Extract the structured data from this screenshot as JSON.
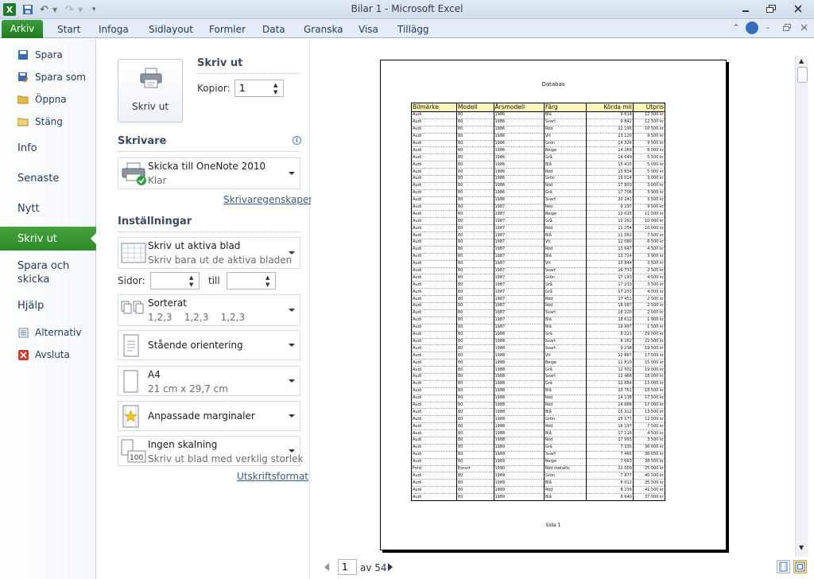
{
  "window": {
    "title": "Bilar 1  -  Microsoft Excel"
  },
  "tabs": [
    "Arkiv",
    "Start",
    "Infoga",
    "Sidlayout",
    "Formler",
    "Data",
    "Granska",
    "Visa",
    "Tillägg"
  ],
  "nav": {
    "spara": "Spara",
    "spara_som": "Spara som",
    "oppna": "Öppna",
    "stang": "Stäng",
    "info": "Info",
    "senaste": "Senaste",
    "nytt": "Nytt",
    "skriv_ut": "Skriv ut",
    "spara_skicka": "Spara och skicka",
    "hjalp": "Hjälp",
    "alternativ": "Alternativ",
    "avsluta": "Avsluta"
  },
  "print": {
    "button_label": "Skriv ut",
    "heading": "Skriv ut",
    "copies_label": "Kopior:",
    "copies_value": "1",
    "printer_heading": "Skrivare",
    "printer_name": "Skicka till OneNote 2010",
    "printer_status": "Klar",
    "printer_props": "Skrivaregenskaper",
    "settings_heading": "Inställningar",
    "what_title": "Skriv ut aktiva blad",
    "what_sub": "Skriv bara ut de aktiva bladen",
    "pages_label": "Sidor:",
    "to_label": "till",
    "collate_title": "Sorterat",
    "collate_sub": "1,2,3    1,2,3    1,2,3",
    "orientation": "Stående orientering",
    "paper_title": "A4",
    "paper_sub": "21 cm x 29,7 cm",
    "margins": "Anpassade marginaler",
    "scaling_title": "Ingen skalning",
    "scaling_sub": "Skriv ut blad med verklig storlek",
    "page_setup": "Utskriftsformat"
  },
  "preview": {
    "page_title": "Databas",
    "page_footer": "Sida 1",
    "current_page": "1",
    "page_total": "av 54",
    "headers": [
      "Bilmärke",
      "Modell",
      "Årsmodell",
      "Färg",
      "Körda mil",
      "Utpris"
    ],
    "rows": [
      [
        "Audi",
        "80",
        "1986",
        "Blå",
        "9 614",
        "12 500 kr"
      ],
      [
        "Audi",
        "80",
        "1986",
        "Svart",
        "9 842",
        "12 500 kr"
      ],
      [
        "Audi",
        "80",
        "1986",
        "Röd",
        "11 195",
        "10 500 kr"
      ],
      [
        "Audi",
        "80",
        "1986",
        "Vit",
        "13 120",
        "9 500 kr"
      ],
      [
        "Audi",
        "80",
        "1986",
        "Grön",
        "14 326",
        "9 500 kr"
      ],
      [
        "Audi",
        "80",
        "1986",
        "Beige",
        "14 269",
        "8 000 kr"
      ],
      [
        "Audi",
        "80",
        "1986",
        "Grå",
        "14 649",
        "5 500 kr"
      ],
      [
        "Audi",
        "80",
        "1986",
        "Blå",
        "15 415",
        "5 000 kr"
      ],
      [
        "Audi",
        "80",
        "1986",
        "Röd",
        "15 834",
        "5 000 kr"
      ],
      [
        "Audi",
        "80",
        "1986",
        "Grön",
        "16 014",
        "3 000 kr"
      ],
      [
        "Audi",
        "80",
        "1986",
        "Röd",
        "17 803",
        "3 000 kr"
      ],
      [
        "Audi",
        "80",
        "1986",
        "Grå",
        "17 706",
        "3 900 kr"
      ],
      [
        "Audi",
        "80",
        "1986",
        "Svart",
        "20 241",
        "3 500 kr"
      ],
      [
        "Audi",
        "80",
        "1987",
        "Röd",
        "9 297",
        "9 500 kr"
      ],
      [
        "Audi",
        "80",
        "1987",
        "Beige",
        "10 025",
        "11 500 kr"
      ],
      [
        "Audi",
        "80",
        "1987",
        "Grå",
        "10 262",
        "10 000 kr"
      ],
      [
        "Audi",
        "80",
        "1987",
        "Röd",
        "11 254",
        "10 000 kr"
      ],
      [
        "Audi",
        "80",
        "1987",
        "Blå",
        "11 562",
        "7 500 kr"
      ],
      [
        "Audi",
        "80",
        "1987",
        "Vit",
        "12 080",
        "6 500 kr"
      ],
      [
        "Audi",
        "80",
        "1987",
        "Röd",
        "13 647",
        "4 500 kr"
      ],
      [
        "Audi",
        "80",
        "1987",
        "Blå",
        "13 724",
        "3 900 kr"
      ],
      [
        "Audi",
        "80",
        "1987",
        "Vit",
        "13 844",
        "3 500 kr"
      ],
      [
        "Audi",
        "80",
        "1987",
        "Svart",
        "16 733",
        "2 500 kr"
      ],
      [
        "Audi",
        "80",
        "1987",
        "Grön",
        "17 193",
        "4 500 kr"
      ],
      [
        "Audi",
        "80",
        "1987",
        "Grå",
        "17 233",
        "3 500 kr"
      ],
      [
        "Audi",
        "80",
        "1987",
        "Grå",
        "17 233",
        "4 000 kr"
      ],
      [
        "Audi",
        "80",
        "1987",
        "Röd",
        "17 451",
        "2 500 kr"
      ],
      [
        "Audi",
        "80",
        "1987",
        "Röd",
        "18 087",
        "2 500 kr"
      ],
      [
        "Audi",
        "80",
        "1987",
        "Svart",
        "18 220",
        "2 000 kr"
      ],
      [
        "Audi",
        "80",
        "1987",
        "Blå",
        "18 612",
        "1 900 kr"
      ],
      [
        "Audi",
        "80",
        "1987",
        "Blå",
        "19 997",
        "1 500 kr"
      ],
      [
        "Audi",
        "80",
        "1988",
        "Grå",
        "8 221",
        "29 000 kr"
      ],
      [
        "Audi",
        "80",
        "1988",
        "Svart",
        "8 262",
        "22 500 kr"
      ],
      [
        "Audi",
        "80",
        "1988",
        "Svart",
        "9 238",
        "19 500 kr"
      ],
      [
        "Audi",
        "80",
        "1988",
        "Vit",
        "10 867",
        "17 500 kr"
      ],
      [
        "Audi",
        "80",
        "1988",
        "Beige",
        "11 810",
        "15 000 kr"
      ],
      [
        "Audi",
        "80",
        "1988",
        "Grå",
        "12 502",
        "19 000 kr"
      ],
      [
        "Audi",
        "80",
        "1988",
        "Svart",
        "12 468",
        "18 000 kr"
      ],
      [
        "Audi",
        "80",
        "1988",
        "Grå",
        "12 884",
        "13 000 kr"
      ],
      [
        "Audi",
        "80",
        "1988",
        "Blå",
        "13 761",
        "18 500 kr"
      ],
      [
        "Audi",
        "80",
        "1988",
        "Röd",
        "14 138",
        "17 500 kr"
      ],
      [
        "Audi",
        "80",
        "1988",
        "Röd",
        "14 986",
        "17 000 kr"
      ],
      [
        "Audi",
        "80",
        "1988",
        "Blå",
        "15 312",
        "13 500 kr"
      ],
      [
        "Audi",
        "80",
        "1988",
        "Grön",
        "15 577",
        "12 500 kr"
      ],
      [
        "Audi",
        "80",
        "1988",
        "Röd",
        "16 197",
        "7 500 kr"
      ],
      [
        "Audi",
        "80",
        "1988",
        "Blå",
        "17 116",
        "4 500 kr"
      ],
      [
        "Audi",
        "80",
        "1988",
        "Röd",
        "17 993",
        "3 500 kr"
      ],
      [
        "Audi",
        "80",
        "1989",
        "Grå",
        "7 335",
        "36 000 kr"
      ],
      [
        "Audi",
        "80",
        "1989",
        "Svart",
        "7 465",
        "36 050 kr"
      ],
      [
        "Audi",
        "80",
        "1989",
        "Beige",
        "7 663",
        "38 500 kr"
      ],
      [
        "Ford",
        "Escort",
        "1990",
        "Röd metallic",
        "11 000",
        "25 000 kr"
      ],
      [
        "Audi",
        "80",
        "1989",
        "Grön",
        "7 877",
        "40 500 kr"
      ],
      [
        "Audi",
        "80",
        "1989",
        "Blå",
        "8 011",
        "35 500 kr"
      ],
      [
        "Audi",
        "80",
        "1989",
        "Röd",
        "8 239",
        "41 500 kr"
      ],
      [
        "Audi",
        "80",
        "1989",
        "Blå",
        "8 640",
        "37 000 kr"
      ]
    ]
  }
}
